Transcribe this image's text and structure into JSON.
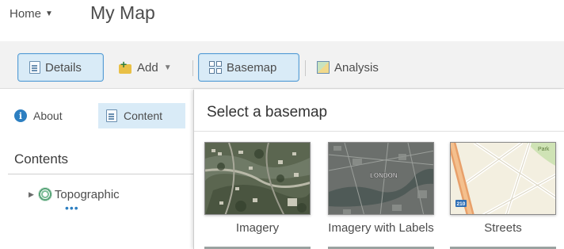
{
  "header": {
    "home_label": "Home",
    "map_title": "My Map"
  },
  "toolbar": {
    "details_label": "Details",
    "add_label": "Add",
    "basemap_label": "Basemap",
    "analysis_label": "Analysis"
  },
  "left_panel": {
    "tabs": [
      {
        "label": "About",
        "icon": "info-icon",
        "active": false
      },
      {
        "label": "Content",
        "icon": "document-icon",
        "active": true
      }
    ],
    "contents_heading": "Contents",
    "layers": [
      {
        "name": "Topographic",
        "icon": "basemap-layer-icon",
        "more": "•••"
      }
    ]
  },
  "basemap_gallery": {
    "title": "Select a basemap",
    "items": [
      {
        "label": "Imagery",
        "thumbnail": "satellite-imagery"
      },
      {
        "label": "Imagery with Labels",
        "thumbnail": "satellite-imagery-labeled",
        "map_text": "LONDON"
      },
      {
        "label": "Streets",
        "thumbnail": "street-map",
        "map_text": [
          "Park",
          "210"
        ]
      }
    ]
  },
  "colors": {
    "active_button_bg": "#d9ebf7",
    "active_button_border": "#5a9fd6",
    "toolbar_bg": "#f2f2f2",
    "info_icon": "#2d7fc1",
    "text": "#4c4c4c"
  }
}
